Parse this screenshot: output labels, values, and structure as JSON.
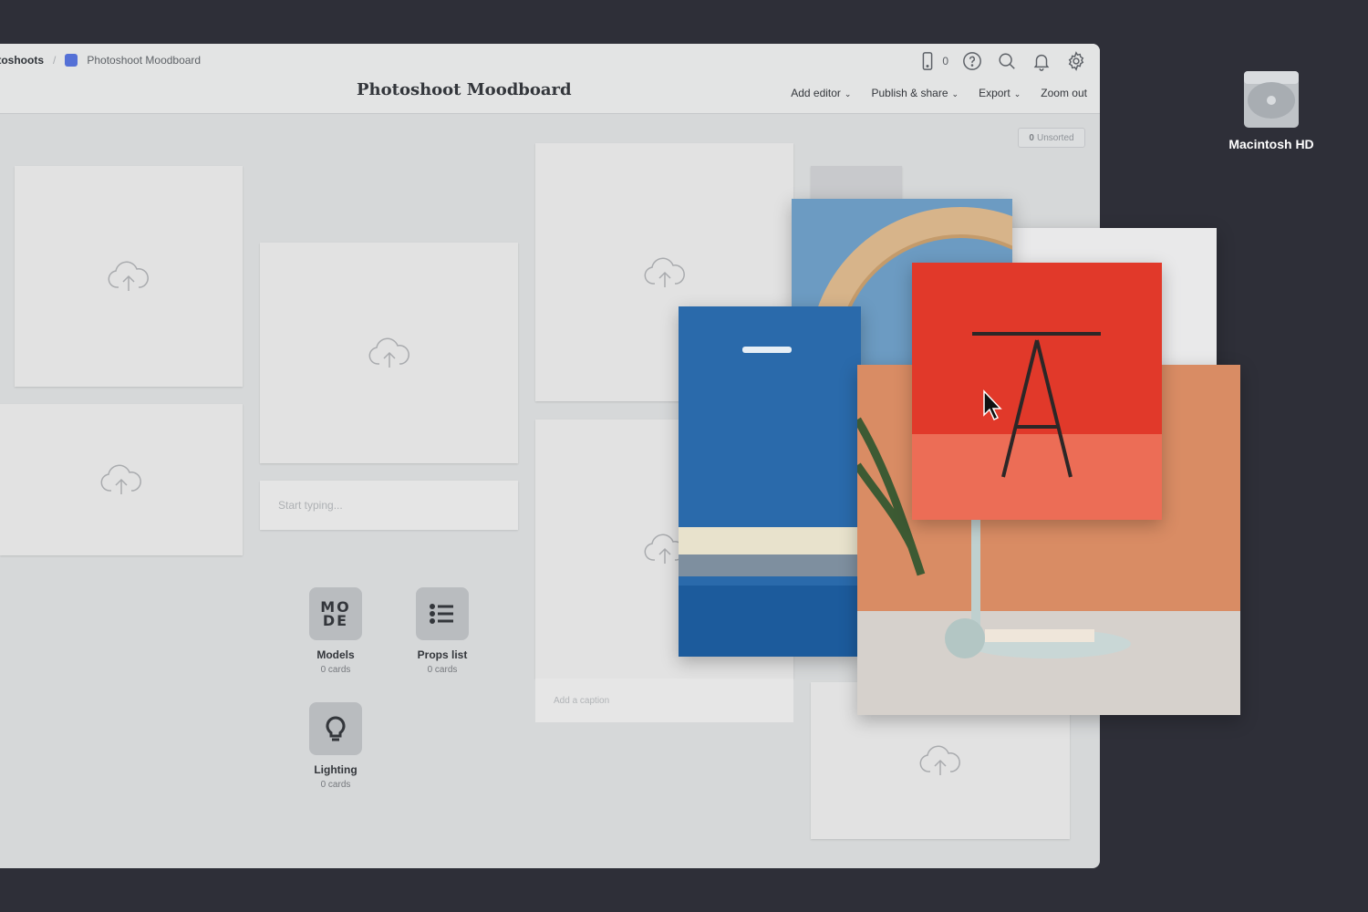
{
  "breadcrumb": {
    "root": "otoshoots",
    "current": "Photoshoot Moodboard",
    "current_color": "#5470d6"
  },
  "header": {
    "title": "Photoshoot Moodboard",
    "phone_count": "0",
    "menu": {
      "add_editor": "Add editor",
      "publish_share": "Publish & share",
      "export": "Export",
      "zoom_out": "Zoom out"
    }
  },
  "board": {
    "unsorted_count": "0",
    "unsorted_label": "Unsorted",
    "note_placeholder": "Start typing...",
    "caption_placeholder": "Add a caption",
    "tiles": [
      {
        "mode_text": "MO DE",
        "label": "Models",
        "count": "0 cards",
        "icon": "mode-text-icon"
      },
      {
        "label": "Props list",
        "count": "0 cards",
        "icon": "list-icon"
      },
      {
        "label": "Lighting",
        "count": "0 cards",
        "icon": "lightbulb-icon"
      }
    ]
  },
  "desktop": {
    "label": "Macintosh HD",
    "icon": "hard-drive-icon"
  },
  "colors": {
    "background": "#2e2f38",
    "window": "#d6d8d9",
    "accent": "#5470d6"
  }
}
